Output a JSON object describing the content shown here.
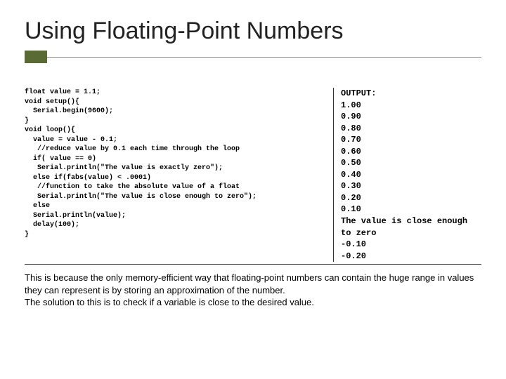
{
  "title": "Using Floating-Point Numbers",
  "code": "float value = 1.1;\nvoid setup(){\n  Serial.begin(9600);\n}\nvoid loop(){\n  value = value - 0.1;\n   //reduce value by 0.1 each time through the loop\n  if( value == 0)\n   Serial.println(\"The value is exactly zero\");\n  else if(fabs(value) < .0001)\n   //function to take the absolute value of a float\n   Serial.println(\"The value is close enough to zero\");\n  else\n  Serial.println(value);\n  delay(100);\n}",
  "output": "OUTPUT:\n1.00\n0.90\n0.80\n0.70\n0.60\n0.50\n0.40\n0.30\n0.20\n0.10\nThe value is close enough\nto zero\n-0.10\n-0.20",
  "explanation": "This is because the only memory-efficient way that floating-point numbers can contain the huge range in values they can represent is by storing an approximation of the number.\nThe solution to this is to check if a variable is close to the desired value."
}
